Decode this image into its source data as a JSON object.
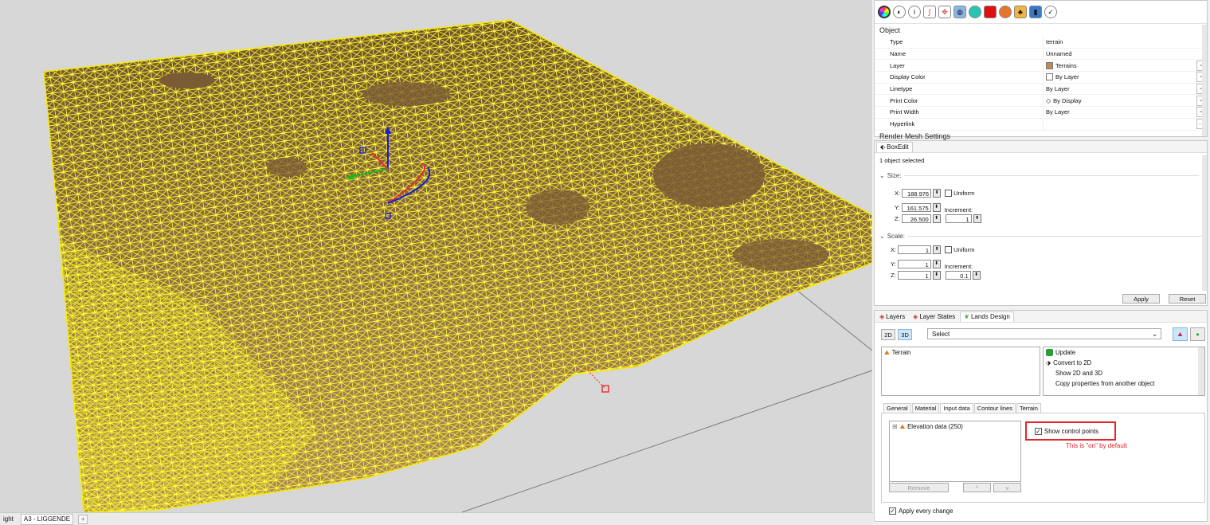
{
  "viewport": {
    "bottom_tabs": [
      "ight",
      "A3 - LIGGENDE"
    ],
    "add_tab": "+"
  },
  "properties": {
    "toolbar_icons": [
      "material-icon",
      "object-icon",
      "info-icon",
      "curve-icon",
      "edit-icon",
      "render-icon",
      "texture-icon",
      "color-icon",
      "decal-icon",
      "hat-icon",
      "cube-icon",
      "check-icon"
    ],
    "section_title": "Object",
    "rows": [
      {
        "key": "Type",
        "value": "terrain"
      },
      {
        "key": "Name",
        "value": "Unnamed"
      },
      {
        "key": "Layer",
        "value": "Terrains",
        "swatch": "#c08a5a"
      },
      {
        "key": "Display Color",
        "value": "By Layer",
        "swatch": "#ffffff"
      },
      {
        "key": "Linetype",
        "value": "By Layer"
      },
      {
        "key": "Print Color",
        "value": "By Display"
      },
      {
        "key": "Print Width",
        "value": "By Layer"
      },
      {
        "key": "Hyperlink",
        "value": ""
      }
    ],
    "next_section": "Render Mesh Settings"
  },
  "boxedit": {
    "tab": "BoxEdit",
    "status": "1 object selected",
    "size_label": "Size:",
    "size": {
      "x": "188.976",
      "y": "161.575",
      "z": "26.500",
      "increment": "1"
    },
    "uniform_label": "Uniform",
    "increment_label": "Increment:",
    "scale_label": "Scale:",
    "scale": {
      "x": "1",
      "y": "1",
      "z": "1",
      "increment": "0.1"
    },
    "apply": "Apply",
    "reset": "Reset"
  },
  "lands": {
    "tabs": [
      "Layers",
      "Layer States",
      "Lands Design"
    ],
    "mode_2d": "2D",
    "mode_3d": "3D",
    "select_value": "Select",
    "object_list": [
      "Terrain"
    ],
    "commands": [
      "Update",
      "Convert to 2D",
      "Show 2D and 3D",
      "Copy properties from another object"
    ],
    "subtabs": [
      "General",
      "Material",
      "Input data",
      "Contour lines",
      "Terrain"
    ],
    "active_subtab": "Input data",
    "input_items": [
      "Elevation data (250)"
    ],
    "tree_expander": "⊞",
    "remove": "Remove",
    "up": "^",
    "down": "v",
    "show_control_points": "Show control points",
    "callout_note": "This is \"on\" by default",
    "apply_every_change": "Apply every change"
  },
  "colors": {
    "terrain_mesh": "#ffff1a",
    "terrain_fill": "#8d6b43",
    "callout": "#e5232b",
    "selection": "#cde6f7"
  }
}
